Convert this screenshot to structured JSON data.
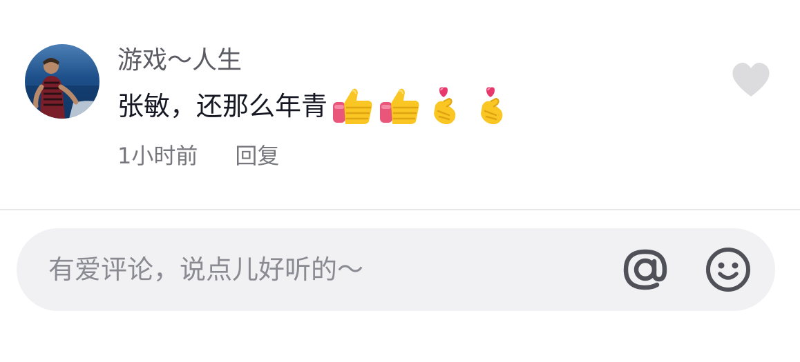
{
  "comment": {
    "username": "游戏～人生",
    "text": "张敏，还那么年青",
    "emojis": [
      "thumbs-up-icon",
      "thumbs-up-icon",
      "finger-heart-icon",
      "finger-heart-icon"
    ],
    "time": "1小时前",
    "reply_label": "回复",
    "like_icon": "heart-icon",
    "avatar_icon": "user-avatar"
  },
  "composer": {
    "placeholder": "有爱评论，说点儿好听的～",
    "mention_icon": "at-icon",
    "emoji_icon": "smile-icon"
  },
  "colors": {
    "username": "#5b5b63",
    "text": "#161823",
    "meta": "#76767d",
    "input_bg": "#f1f1f3",
    "icon": "#505058",
    "like": "#dcdcde"
  }
}
